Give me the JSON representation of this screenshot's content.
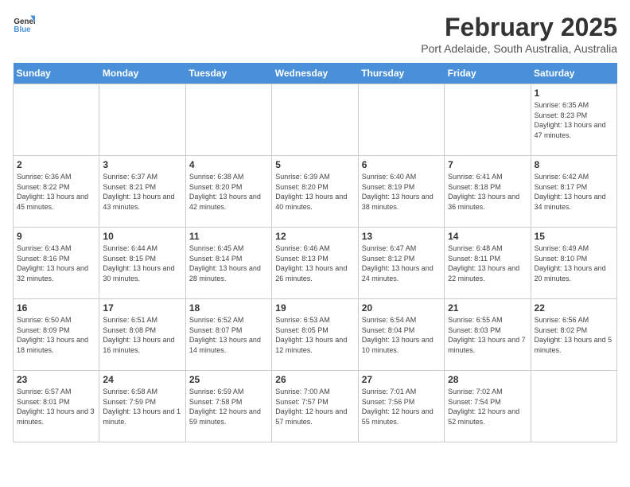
{
  "header": {
    "logo_general": "General",
    "logo_blue": "Blue",
    "month": "February 2025",
    "location": "Port Adelaide, South Australia, Australia"
  },
  "weekdays": [
    "Sunday",
    "Monday",
    "Tuesday",
    "Wednesday",
    "Thursday",
    "Friday",
    "Saturday"
  ],
  "weeks": [
    [
      {
        "day": "",
        "info": ""
      },
      {
        "day": "",
        "info": ""
      },
      {
        "day": "",
        "info": ""
      },
      {
        "day": "",
        "info": ""
      },
      {
        "day": "",
        "info": ""
      },
      {
        "day": "",
        "info": ""
      },
      {
        "day": "1",
        "info": "Sunrise: 6:35 AM\nSunset: 8:23 PM\nDaylight: 13 hours and 47 minutes."
      }
    ],
    [
      {
        "day": "2",
        "info": "Sunrise: 6:36 AM\nSunset: 8:22 PM\nDaylight: 13 hours and 45 minutes."
      },
      {
        "day": "3",
        "info": "Sunrise: 6:37 AM\nSunset: 8:21 PM\nDaylight: 13 hours and 43 minutes."
      },
      {
        "day": "4",
        "info": "Sunrise: 6:38 AM\nSunset: 8:20 PM\nDaylight: 13 hours and 42 minutes."
      },
      {
        "day": "5",
        "info": "Sunrise: 6:39 AM\nSunset: 8:20 PM\nDaylight: 13 hours and 40 minutes."
      },
      {
        "day": "6",
        "info": "Sunrise: 6:40 AM\nSunset: 8:19 PM\nDaylight: 13 hours and 38 minutes."
      },
      {
        "day": "7",
        "info": "Sunrise: 6:41 AM\nSunset: 8:18 PM\nDaylight: 13 hours and 36 minutes."
      },
      {
        "day": "8",
        "info": "Sunrise: 6:42 AM\nSunset: 8:17 PM\nDaylight: 13 hours and 34 minutes."
      }
    ],
    [
      {
        "day": "9",
        "info": "Sunrise: 6:43 AM\nSunset: 8:16 PM\nDaylight: 13 hours and 32 minutes."
      },
      {
        "day": "10",
        "info": "Sunrise: 6:44 AM\nSunset: 8:15 PM\nDaylight: 13 hours and 30 minutes."
      },
      {
        "day": "11",
        "info": "Sunrise: 6:45 AM\nSunset: 8:14 PM\nDaylight: 13 hours and 28 minutes."
      },
      {
        "day": "12",
        "info": "Sunrise: 6:46 AM\nSunset: 8:13 PM\nDaylight: 13 hours and 26 minutes."
      },
      {
        "day": "13",
        "info": "Sunrise: 6:47 AM\nSunset: 8:12 PM\nDaylight: 13 hours and 24 minutes."
      },
      {
        "day": "14",
        "info": "Sunrise: 6:48 AM\nSunset: 8:11 PM\nDaylight: 13 hours and 22 minutes."
      },
      {
        "day": "15",
        "info": "Sunrise: 6:49 AM\nSunset: 8:10 PM\nDaylight: 13 hours and 20 minutes."
      }
    ],
    [
      {
        "day": "16",
        "info": "Sunrise: 6:50 AM\nSunset: 8:09 PM\nDaylight: 13 hours and 18 minutes."
      },
      {
        "day": "17",
        "info": "Sunrise: 6:51 AM\nSunset: 8:08 PM\nDaylight: 13 hours and 16 minutes."
      },
      {
        "day": "18",
        "info": "Sunrise: 6:52 AM\nSunset: 8:07 PM\nDaylight: 13 hours and 14 minutes."
      },
      {
        "day": "19",
        "info": "Sunrise: 6:53 AM\nSunset: 8:05 PM\nDaylight: 13 hours and 12 minutes."
      },
      {
        "day": "20",
        "info": "Sunrise: 6:54 AM\nSunset: 8:04 PM\nDaylight: 13 hours and 10 minutes."
      },
      {
        "day": "21",
        "info": "Sunrise: 6:55 AM\nSunset: 8:03 PM\nDaylight: 13 hours and 7 minutes."
      },
      {
        "day": "22",
        "info": "Sunrise: 6:56 AM\nSunset: 8:02 PM\nDaylight: 13 hours and 5 minutes."
      }
    ],
    [
      {
        "day": "23",
        "info": "Sunrise: 6:57 AM\nSunset: 8:01 PM\nDaylight: 13 hours and 3 minutes."
      },
      {
        "day": "24",
        "info": "Sunrise: 6:58 AM\nSunset: 7:59 PM\nDaylight: 13 hours and 1 minute."
      },
      {
        "day": "25",
        "info": "Sunrise: 6:59 AM\nSunset: 7:58 PM\nDaylight: 12 hours and 59 minutes."
      },
      {
        "day": "26",
        "info": "Sunrise: 7:00 AM\nSunset: 7:57 PM\nDaylight: 12 hours and 57 minutes."
      },
      {
        "day": "27",
        "info": "Sunrise: 7:01 AM\nSunset: 7:56 PM\nDaylight: 12 hours and 55 minutes."
      },
      {
        "day": "28",
        "info": "Sunrise: 7:02 AM\nSunset: 7:54 PM\nDaylight: 12 hours and 52 minutes."
      },
      {
        "day": "",
        "info": ""
      }
    ]
  ]
}
